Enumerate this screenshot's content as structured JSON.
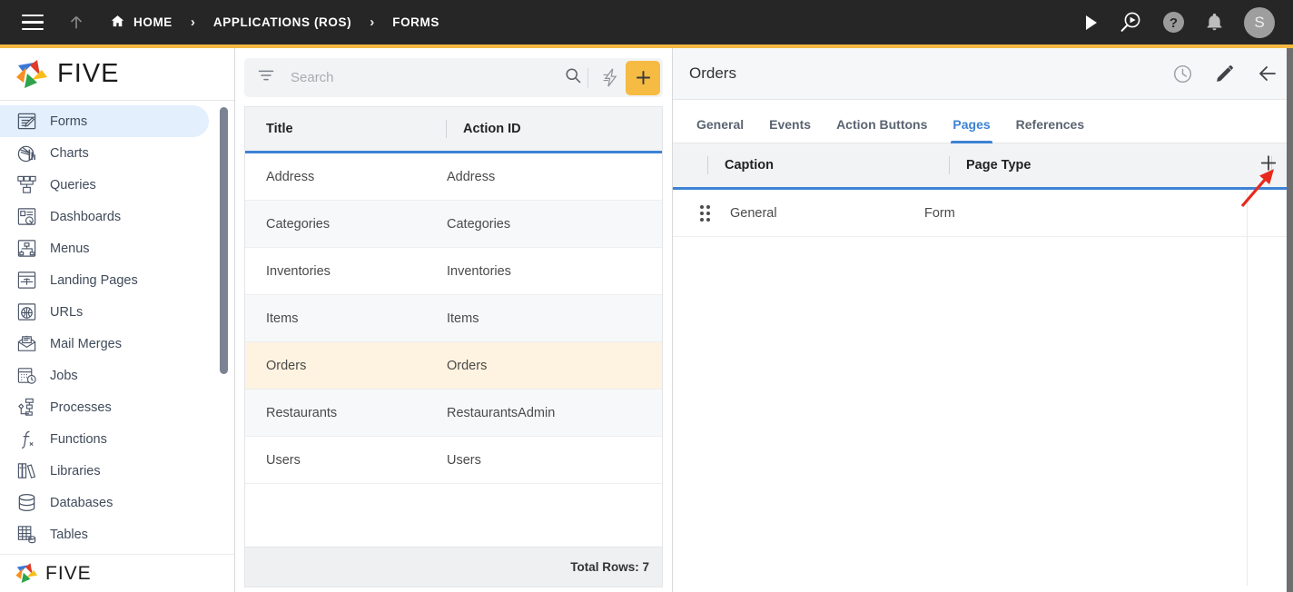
{
  "topbar": {
    "menu_icon": "hamburger-icon",
    "up_icon": "arrow-up-icon",
    "breadcrumb": [
      {
        "label": "HOME",
        "icon": "home-icon"
      },
      {
        "label": "APPLICATIONS (ROS)",
        "icon": ""
      },
      {
        "label": "FORMS",
        "icon": ""
      }
    ],
    "separator": "›",
    "icons": [
      {
        "name": "run-play-icon",
        "glyph": "▶"
      },
      {
        "name": "search-preview-icon",
        "glyph": ""
      },
      {
        "name": "help-icon",
        "glyph": "?"
      },
      {
        "name": "notifications-bell-icon",
        "glyph": ""
      }
    ],
    "avatar_initial": "S",
    "background": "#262626",
    "accent": "#f4b942"
  },
  "sidebar": {
    "brand": "FIVE",
    "brand_bottom": "FIVE",
    "items": [
      {
        "label": "Forms",
        "icon": "forms-icon",
        "active": true
      },
      {
        "label": "Charts",
        "icon": "charts-icon",
        "active": false
      },
      {
        "label": "Queries",
        "icon": "queries-icon",
        "active": false
      },
      {
        "label": "Dashboards",
        "icon": "dashboards-icon",
        "active": false
      },
      {
        "label": "Menus",
        "icon": "menus-icon",
        "active": false
      },
      {
        "label": "Landing Pages",
        "icon": "landing-pages-icon",
        "active": false
      },
      {
        "label": "URLs",
        "icon": "urls-icon",
        "active": false
      },
      {
        "label": "Mail Merges",
        "icon": "mail-merges-icon",
        "active": false
      },
      {
        "label": "Jobs",
        "icon": "jobs-icon",
        "active": false
      },
      {
        "label": "Processes",
        "icon": "processes-icon",
        "active": false
      },
      {
        "label": "Functions",
        "icon": "functions-icon",
        "active": false
      },
      {
        "label": "Libraries",
        "icon": "libraries-icon",
        "active": false
      },
      {
        "label": "Databases",
        "icon": "databases-icon",
        "active": false
      },
      {
        "label": "Tables",
        "icon": "tables-icon",
        "active": false
      }
    ],
    "active_bg": "#e3effc"
  },
  "list_panel": {
    "search": {
      "placeholder": "Search",
      "value": ""
    },
    "filter_icon": "filter-icon",
    "search_icon": "search-icon",
    "bolt_icon": "lightning-bolt-icon",
    "add_label": "+",
    "add_color": "#f6bb42",
    "columns": [
      "Title",
      "Action ID"
    ],
    "rows": [
      {
        "title": "Address",
        "action_id": "Address",
        "selected": false
      },
      {
        "title": "Categories",
        "action_id": "Categories",
        "selected": false
      },
      {
        "title": "Inventories",
        "action_id": "Inventories",
        "selected": false
      },
      {
        "title": "Items",
        "action_id": "Items",
        "selected": false
      },
      {
        "title": "Orders",
        "action_id": "Orders",
        "selected": true
      },
      {
        "title": "Restaurants",
        "action_id": "RestaurantsAdmin",
        "selected": false
      },
      {
        "title": "Users",
        "action_id": "Users",
        "selected": false
      }
    ],
    "footer": "Total Rows: 7",
    "selected_bg": "#fdf3e0"
  },
  "detail_panel": {
    "title": "Orders",
    "header_icons": [
      {
        "name": "history-clock-icon"
      },
      {
        "name": "edit-pencil-icon"
      },
      {
        "name": "back-arrow-icon"
      }
    ],
    "tabs": [
      {
        "label": "General",
        "active": false
      },
      {
        "label": "Events",
        "active": false
      },
      {
        "label": "Action Buttons",
        "active": false
      },
      {
        "label": "Pages",
        "active": true
      },
      {
        "label": "References",
        "active": false
      }
    ],
    "columns": [
      "Caption",
      "Page Type"
    ],
    "add_label": "+",
    "rows": [
      {
        "caption": "General",
        "page_type": "Form"
      }
    ],
    "accent": "#3d82d4"
  },
  "annotation": {
    "type": "red-arrow",
    "color": "#e8291c",
    "points_to": "add-page-button"
  }
}
